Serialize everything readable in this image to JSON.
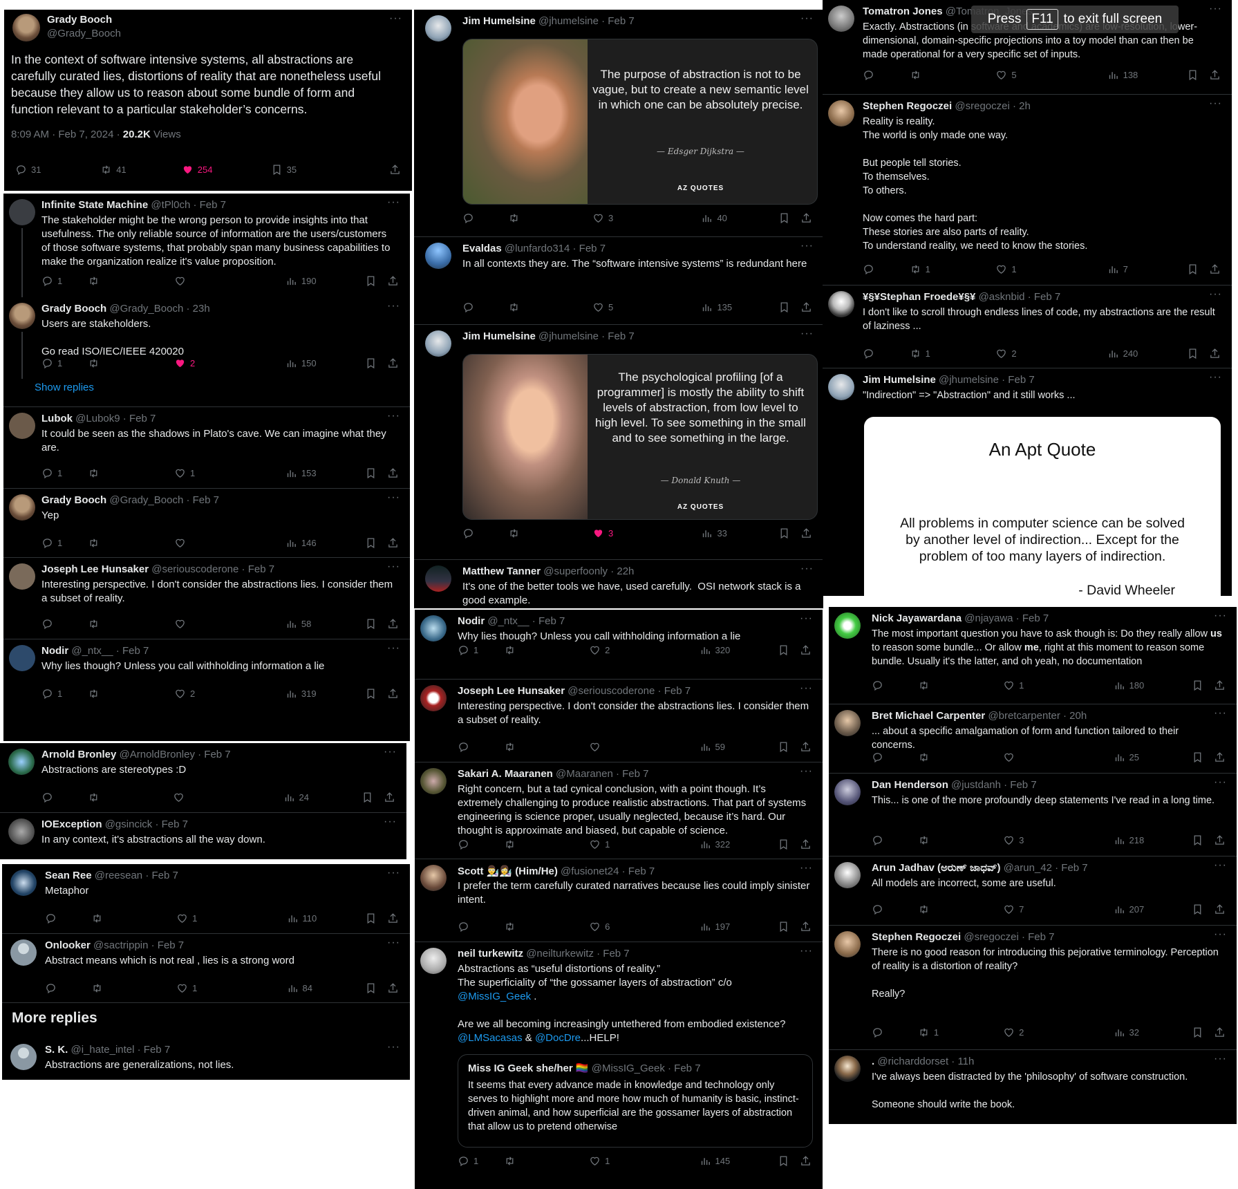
{
  "colors": {
    "background": "#000000",
    "text": "#e7e9ea",
    "muted": "#71767b",
    "like": "#f91880",
    "link": "#1d9bf0"
  },
  "icons": {
    "reply": "reply-icon",
    "retweet": "retweet-icon",
    "like": "heart-icon",
    "views": "views-icon",
    "bookmark": "bookmark-icon",
    "share": "share-icon"
  },
  "fullscreen_hint": {
    "prefix": "Press",
    "key": "F11",
    "suffix": "to exit full screen"
  },
  "main": {
    "name": "Grady Booch",
    "handle": "@Grady_Booch",
    "text": "In the context of software intensive systems, all abstractions are carefully curated lies, distortions of reality that are nonetheless useful because they allow us to reason about some bundle of form and function relevant to a particular stakeholder’s concerns.",
    "time": "8:09 AM · Feb 7, 2024 · ",
    "views_count": "20.2K",
    "views_label": " Views",
    "replies": "31",
    "retweets": "41",
    "likes": "254",
    "bookmarks": "35"
  },
  "col1": [
    {
      "name": "Infinite State Machine",
      "handle": "@tPl0ch · Feb 7",
      "text": "The stakeholder might be the wrong person to provide insights into that usefulness. The only reliable source of information are the users/customers of those software systems, that probably span many business capabilities to make the organization realize it's value proposition.",
      "replies": "1",
      "retweets": "",
      "likes": "",
      "views": "190"
    },
    {
      "name": "Grady Booch",
      "handle": "@Grady_Booch · 23h",
      "text": "Users are stakeholders.\n\nGo read ISO/IEC/IEEE 420020",
      "replies": "1",
      "retweets": "",
      "likes": "2",
      "views": "150"
    },
    {
      "show_replies": "Show replies"
    },
    {
      "name": "Lubok",
      "handle": "@Lubok9 · Feb 7",
      "text": "It could be seen as the shadows in Plato's cave. We can imagine what they are.",
      "replies": "1",
      "retweets": "",
      "likes": "1",
      "views": "153"
    },
    {
      "name": "Grady Booch",
      "handle": "@Grady_Booch · Feb 7",
      "text": "Yep",
      "replies": "1",
      "retweets": "",
      "likes": "",
      "views": "146"
    },
    {
      "name": "Joseph Lee Hunsaker",
      "handle": "@seriouscoderone · Feb 7",
      "text": "Interesting perspective. I don't consider the abstractions lies. I consider them a subset of reality.",
      "replies": "",
      "retweets": "",
      "likes": "",
      "views": "58"
    },
    {
      "name": "Nodir",
      "handle": "@_ntx__ · Feb 7",
      "text": "Why lies though? Unless you call withholding information a lie",
      "replies": "1",
      "retweets": "",
      "likes": "2",
      "views": "319"
    }
  ],
  "col1b": [
    {
      "name": "Arnold Bronley",
      "handle": "@ArnoldBronley · Feb 7",
      "text": "Abstractions are stereotypes :D",
      "replies": "",
      "retweets": "",
      "likes": "",
      "views": "24"
    },
    {
      "name": "IOException",
      "handle": "@gsincick · Feb 7",
      "text": "In any context, it's abstractions all the way down."
    }
  ],
  "col1c": [
    {
      "name": "Sean Ree",
      "handle": "@reesean · Feb 7",
      "text": "Metaphor",
      "replies": "",
      "retweets": "",
      "likes": "1",
      "views": "110"
    },
    {
      "name": "Onlooker",
      "handle": "@sactrippin · Feb 7",
      "text": "Abstract means which is not real , lies is a strong word",
      "replies": "",
      "retweets": "",
      "likes": "1",
      "views": "84"
    },
    {
      "section": "More replies"
    },
    {
      "name": "S. K.",
      "handle": "@i_hate_intel · Feb 7",
      "text": "Abstractions are generalizations, not lies."
    }
  ],
  "col2": [
    {
      "name": "Jim Humelsine",
      "handle": "@jhumelsine · Feb 7",
      "quote": "The purpose of abstraction is not to be vague, but to create a new semantic level in which one can be absolutely precise.",
      "quote_author": "— Edsger Dijkstra —",
      "logo": "AZ QUOTES",
      "replies": "",
      "retweets": "",
      "likes": "3",
      "views": "40"
    },
    {
      "name": "Evaldas",
      "handle": "@lunfardo314 · Feb 7",
      "text": "In all contexts they are. The “software intensive systems” is redundant here",
      "replies": "",
      "retweets": "",
      "likes": "5",
      "views": "135"
    },
    {
      "name": "Jim Humelsine",
      "handle": "@jhumelsine · Feb 7",
      "quote": "The psychological profiling [of a programmer] is mostly the ability to shift levels of abstraction, from low level to high level. To see something in the small and to see something in the large.",
      "quote_author": "— Donald Knuth —",
      "logo": "AZ QUOTES",
      "replies": "",
      "retweets": "",
      "likes": "3",
      "views": "33"
    },
    {
      "name": "Matthew Tanner",
      "handle": "@superfoonly · 22h",
      "text": "It's one of the better tools we have, used carefully.  OSI network stack is a good example."
    }
  ],
  "col2b": [
    {
      "name": "Nodir",
      "handle": "@_ntx__ · Feb 7",
      "text": "Why lies though? Unless you call withholding information a lie",
      "replies": "1",
      "retweets": "",
      "likes": "2",
      "views": "320"
    },
    {
      "name": "Joseph Lee Hunsaker",
      "handle": "@seriouscoderone · Feb 7",
      "text": "Interesting perspective. I don't consider the abstractions lies. I consider them a subset of reality.",
      "replies": "",
      "retweets": "",
      "likes": "",
      "views": "59"
    },
    {
      "name": "Sakari A. Maaranen",
      "handle": "@Maaranen · Feb 7",
      "text": "Right concern, but a tad cynical conclusion, with a point though. It’s extremely challenging to produce realistic abstractions. That part of systems engineering is science proper, usually neglected, because it’s hard. Our thought is approximate and biased, but capable of science.",
      "replies": "",
      "retweets": "",
      "likes": "1",
      "views": "322"
    },
    {
      "name": "Scott 👨‍🔬👩‍🔬 (Him/He)",
      "handle": "@fusionet24 · Feb 7",
      "text": "I prefer the term carefully curated narratives because lies could imply sinister intent.",
      "replies": "",
      "retweets": "",
      "likes": "6",
      "views": "197"
    },
    {
      "name": "neil turkewitz",
      "handle": "@neilturkewitz · Feb 7",
      "text1": "Abstractions as “useful distortions of reality.”\nThe superficiality of “the gossamer layers of abstraction” c/o",
      "mention1": "@MissIG_Geek",
      "text2": " .\n\nAre we all becoming increasingly untethered from embodied existence?",
      "mention2": "@LMSacasas",
      "amp": " & ",
      "mention3": "@DocDre",
      "text3": "...HELP!",
      "quoted_name": "Miss IG Geek she/her 🏳️‍🌈",
      "quoted_handle": "@MissIG_Geek · Feb 7",
      "quoted_text": "It seems that every advance made in knowledge and technology only serves to highlight more and more how much of humanity is basic, instinct-driven animal, and how superficial are the gossamer layers of abstraction that allow us to pretend otherwise",
      "replies": "1",
      "retweets": "",
      "likes": "1",
      "views": "145"
    }
  ],
  "col3": [
    {
      "name": "Tomatron Jones",
      "handle": "@Tomatron_Jones",
      "text": "Exactly. Abstractions (in software and academics) are low-resolution, lower-dimensional, domain-specific projections into a toy model than can then be made operational for a very specific set of inputs.",
      "replies": "",
      "retweets": "",
      "likes": "5",
      "views": "138"
    },
    {
      "name": "Stephen Regoczei",
      "handle": "@sregoczei · 2h",
      "text": "Reality is reality.\nThe world is only made one way.\n\nBut people tell stories.\nTo themselves.\nTo others.\n\nNow comes the hard part:\nThese stories are also parts of reality.\nTo understand reality, we need to know the stories.",
      "replies": "",
      "retweets": "1",
      "likes": "1",
      "views": "7"
    },
    {
      "name": "¥§¥Stephan Froede¥§¥",
      "handle": "@asknbid · Feb 7",
      "text": "I don't like to scroll through endless lines of code, my abstractions are the result of laziness ...",
      "replies": "",
      "retweets": "1",
      "likes": "2",
      "views": "240"
    },
    {
      "name": "Jim Humelsine",
      "handle": "@jhumelsine · Feb 7",
      "text": "\"Indirection\" => \"Abstraction\" and it still works ...",
      "card_title": "An Apt Quote",
      "card_quote": "All problems in computer science can be solved by another level of indirection... Except for the problem of too many layers of indirection.",
      "card_author": "- David Wheeler"
    }
  ],
  "col3b": [
    {
      "name": "Nick Jayawardana",
      "handle": "@njayawa · Feb 7",
      "text_html": [
        "The most important question you have to ask though is: Do they really allow ",
        "us",
        " to reason some bundle... Or allow ",
        "me",
        ", right at this moment to reason some bundle. Usually it's the latter, and oh yeah, no documentation"
      ],
      "replies": "",
      "retweets": "",
      "likes": "1",
      "views": "180"
    },
    {
      "name": "Bret Michael Carpenter",
      "handle": "@bretcarpenter · 20h",
      "text": "... about a specific amalgamation of form and function tailored to their concerns.",
      "replies": "",
      "retweets": "",
      "likes": "",
      "views": "25"
    },
    {
      "name": "Dan Henderson",
      "handle": "@justdanh · Feb 7",
      "text": "This... is one of the more profoundly deep statements I've read in a long time.",
      "replies": "",
      "retweets": "",
      "likes": "3",
      "views": "218"
    },
    {
      "name": "Arun Jadhav (ಅರುಣ್ ಜಾಧವ್)",
      "handle": "@arun_42 · Feb 7",
      "text": "All models are incorrect, some are useful.",
      "replies": "",
      "retweets": "",
      "likes": "7",
      "views": "207"
    },
    {
      "name": "Stephen Regoczei",
      "handle": "@sregoczei · Feb 7",
      "text": "There is no good reason for introducing this pejorative terminology. Perception of reality is a distortion of reality?\n\nReally?",
      "replies": "",
      "retweets": "1",
      "likes": "2",
      "views": "32"
    },
    {
      "name": ".",
      "handle": "@richarddorset · 11h",
      "text": "I've always been distracted by the 'philosophy' of software construction.\n\nSomeone should write the book."
    }
  ]
}
